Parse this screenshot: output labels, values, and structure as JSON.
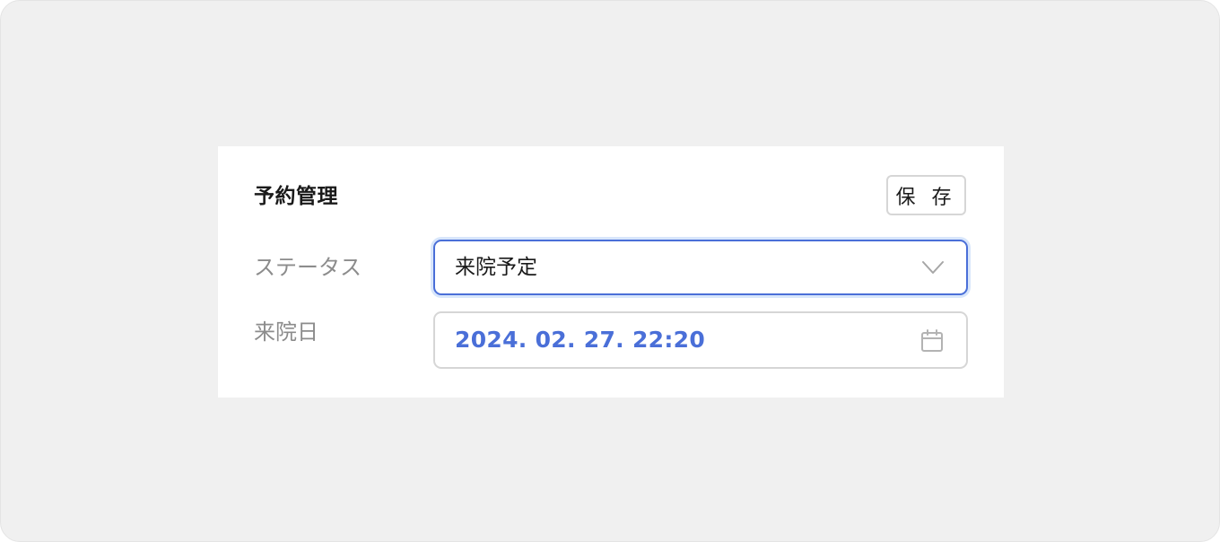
{
  "card": {
    "title": "予約管理",
    "save_label": "保 存"
  },
  "fields": {
    "status_label": "ステータス",
    "status_value": "来院予定",
    "visit_date_label": "来院日",
    "visit_date_value": "2024. 02. 27. 22:20"
  },
  "icons": {
    "status_dropdown": "chevron-down-icon",
    "date_picker": "calendar-icon"
  },
  "colors": {
    "accent": "#4a6fd8",
    "focus_ring": "#d8e6fb",
    "label": "#8c8c8c",
    "background": "#f0f0f0"
  }
}
